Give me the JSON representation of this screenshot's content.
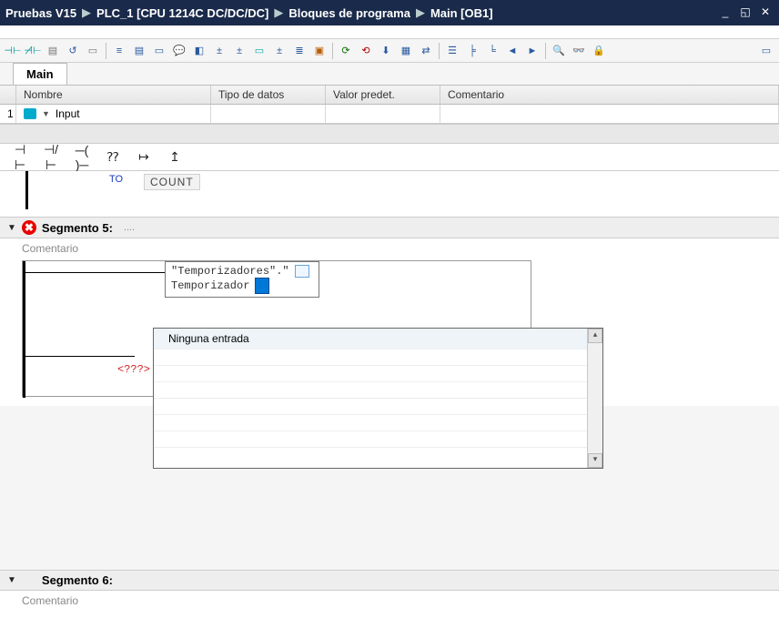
{
  "titlebar": {
    "crumbs": [
      "Pruebas V15",
      "PLC_1 [CPU 1214C DC/DC/DC]",
      "Bloques de programa",
      "Main [OB1]"
    ]
  },
  "tab": {
    "label": "Main"
  },
  "iface": {
    "headers": {
      "nombre": "Nombre",
      "tipo": "Tipo de datos",
      "valor": "Valor predet.",
      "comentario": "Comentario"
    },
    "row": {
      "num": "1",
      "label": "Input"
    }
  },
  "fav": {
    "contact": "⊣ ⊢",
    "ncontact": "⊣/⊢",
    "coil": "─( )─",
    "box": "⁇",
    "branch_open": "↦",
    "branch_close": "↥"
  },
  "editor": {
    "count_fragment": "COUNT",
    "to_fragment": "TO"
  },
  "segment5": {
    "title": "Segmento 5:",
    "ellipsis": "....",
    "comment_label": "Comentario",
    "tag_line1": "\"Temporizadores\".\"",
    "tag_line2": "Temporizador",
    "placeholder": "<???>"
  },
  "dropdown": {
    "item": "Ninguna entrada"
  },
  "segment6": {
    "title": "Segmento 6:",
    "comment_label": "Comentario"
  }
}
